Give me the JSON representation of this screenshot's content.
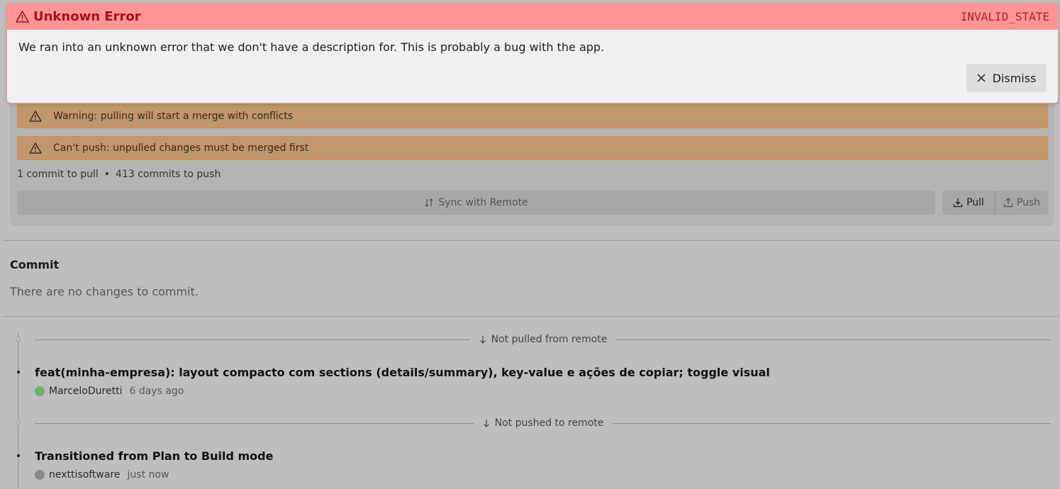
{
  "error_toast": {
    "title": "Unknown Error",
    "code": "INVALID_STATE",
    "message": "We ran into an unknown error that we don't have a description for. This is probably a bug with the app.",
    "dismiss_label": "Dismiss",
    "icons": {
      "title": "warning-triangle-icon",
      "dismiss": "close-icon"
    },
    "colors": {
      "header_bg": "#ff9494",
      "title": "#a4121b"
    }
  },
  "remote": {
    "warnings": [
      {
        "text": "Warning: pulling will start a merge with conflicts",
        "icon": "warning-triangle-icon"
      },
      {
        "text": "Can't push: unpulled changes must be merged first",
        "icon": "warning-triangle-icon"
      }
    ],
    "stats": {
      "to_pull": "1 commit to pull",
      "separator": "•",
      "to_push": "413 commits to push"
    },
    "sync_label": "Sync with Remote",
    "pull_label": "Pull",
    "push_label": "Push",
    "colors": {
      "warning_bg": "#c0966d",
      "warning_border": "#d58a3c"
    }
  },
  "commit": {
    "heading": "Commit",
    "empty_text": "There are no changes to commit."
  },
  "history": {
    "dividers": [
      {
        "label": "Not pulled from remote",
        "icon": "arrow-down-icon"
      },
      {
        "label": "Not pushed to remote",
        "icon": "arrow-down-icon"
      }
    ],
    "commits": [
      {
        "title": "feat(minha-empresa): layout compacto com sections (details/summary), key-value e ações de copiar; toggle visual",
        "author": "MarceloDuretti",
        "time": "6 days ago",
        "avatar_color": "#6fb06b"
      },
      {
        "title": "Transitioned from Plan to Build mode",
        "author": "nexttisoftware",
        "time": "just now",
        "avatar_color": "#8a8a8a"
      }
    ]
  }
}
